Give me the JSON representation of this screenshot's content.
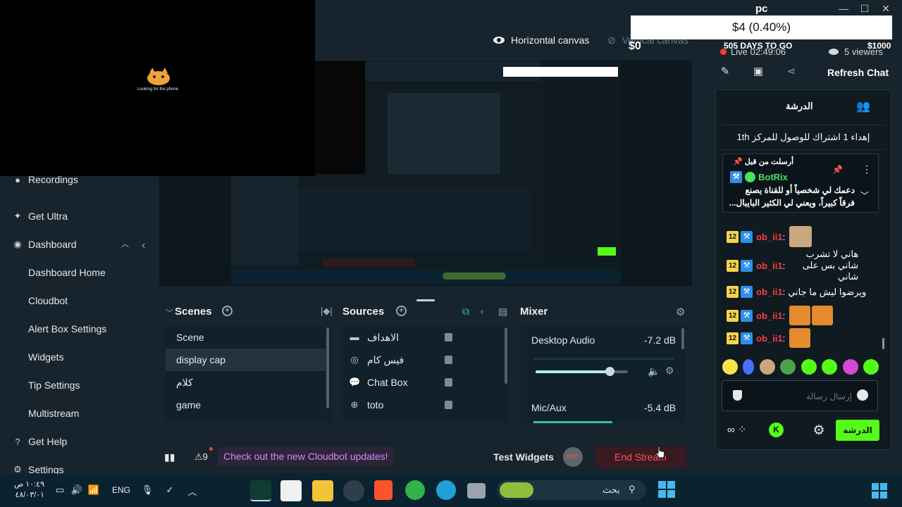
{
  "window": {
    "title": "pc",
    "minimize": "—",
    "maximize": "☐",
    "close": "✕"
  },
  "camera_overlay": {
    "text": "Looking for the phone"
  },
  "canvas_tabs": {
    "horizontal": "Horizontal canvas",
    "vertical": "Vertical canvas"
  },
  "goal": {
    "amount": "$4 (0.40%)",
    "left": "$0",
    "right": "$1000",
    "days": "505 DAYS TO GO"
  },
  "stream_status": {
    "live": "Live 02:49:06",
    "viewers": "5 viewers"
  },
  "chat_header": {
    "refresh": "Refresh Chat"
  },
  "sidebar": {
    "items": [
      {
        "label": "Recordings",
        "icon": "record-icon"
      },
      {
        "label": "Get Ultra",
        "icon": "ultra-icon"
      },
      {
        "label": "Dashboard",
        "icon": "dashboard-icon"
      },
      {
        "label": "Dashboard Home"
      },
      {
        "label": "Cloudbot"
      },
      {
        "label": "Alert Box Settings"
      },
      {
        "label": "Widgets"
      },
      {
        "label": "Tip Settings"
      },
      {
        "label": "Multistream"
      },
      {
        "label": "Get Help",
        "icon": "help-icon"
      },
      {
        "label": "Settings",
        "icon": "settings-icon"
      }
    ]
  },
  "scenes": {
    "title": "Scenes",
    "items": [
      "Scene",
      "display cap",
      "كلام",
      "game"
    ],
    "selected": "display cap"
  },
  "sources": {
    "title": "Sources",
    "items": [
      {
        "label": "الاهداف",
        "icon": "folder-icon"
      },
      {
        "label": "فيس كام",
        "icon": "webcam-icon"
      },
      {
        "label": "Chat Box",
        "icon": "chat-icon"
      },
      {
        "label": "toto",
        "icon": "globe-icon"
      }
    ]
  },
  "mixer": {
    "title": "Mixer",
    "channels": [
      {
        "name": "Desktop Audio",
        "db": "-7.2 dB",
        "level": 0.8
      },
      {
        "name": "Mic/Aux",
        "db": "-5.4 dB"
      }
    ]
  },
  "statusbar": {
    "notice": "Check out the new Cloudbot updates!",
    "test_widgets": "Test Widgets",
    "rec": "REC",
    "end_stream": "End Stream",
    "warnings": "9"
  },
  "chat": {
    "tab": "الدرشة",
    "banner": "إهداء 1 اشتراك للوصول للمركز 1th",
    "pinned": {
      "header": "أرسلت من قبل",
      "user": "BotRix",
      "text": "دعمك لي شخصياً أو للقناة يصنع فرقاً كبيراً، ويعني لي الكثير البايبال..."
    },
    "messages": [
      {
        "badge": "12",
        "user": "ob_ii1",
        "text": ""
      },
      {
        "badge": "12",
        "user": "ob_ii1",
        "text": "هاني لا تشرب شاني بس على شاني"
      },
      {
        "badge": "12",
        "user": "ob_ii1",
        "text": "ويرضوا ليش ما جاني"
      },
      {
        "badge": "12",
        "user": "ob_ii1",
        "text": ""
      },
      {
        "badge": "12",
        "user": "ob_ii1",
        "text": ""
      }
    ],
    "input_placeholder": "إرسال رسالة",
    "send_label": "الدرشة"
  },
  "taskbar": {
    "clock_time": "١٠:٤٩ ص",
    "clock_date": "٤٨/٠٣/٠١",
    "lang": "ENG",
    "search": "بحث"
  },
  "colors": {
    "kick_green": "#53fc18",
    "live_red": "#ff3b30",
    "accent_teal": "#31c3a2",
    "username_red": "#ff3b3b"
  }
}
